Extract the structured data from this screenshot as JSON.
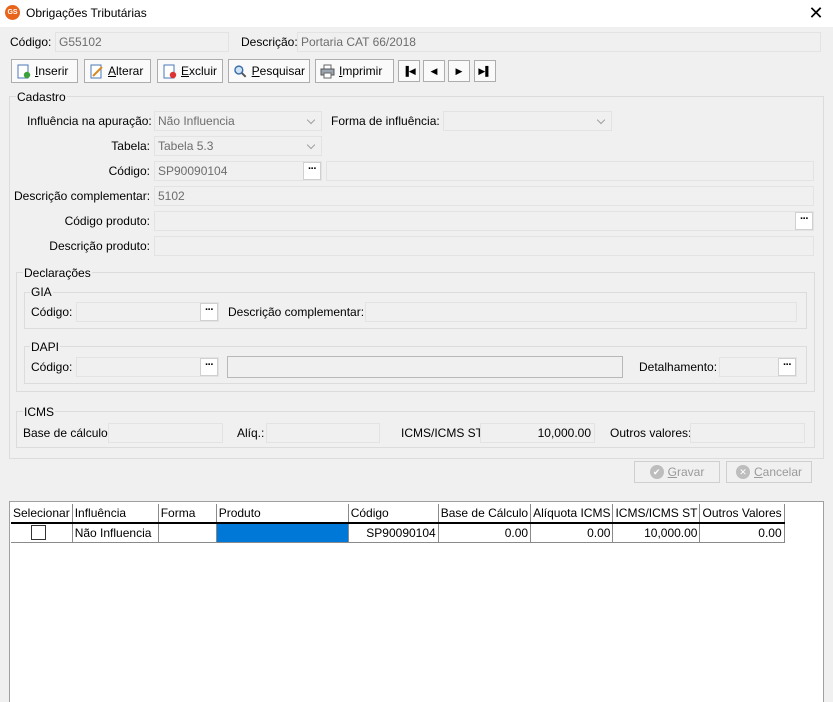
{
  "window": {
    "title": "Obrigações Tributárias",
    "app_icon": "GS"
  },
  "header": {
    "codigo_label": "Código:",
    "codigo_value": "G55102",
    "descricao_label": "Descrição:",
    "descricao_value": "Portaria CAT 66/2018"
  },
  "toolbar": {
    "inserir": "Inserir",
    "alterar": "Alterar",
    "excluir": "Excluir",
    "pesquisar": "Pesquisar",
    "imprimir": "Imprimir"
  },
  "cadastro": {
    "title": "Cadastro",
    "influencia_label": "Influência na apuração:",
    "influencia_value": "Não Influencia",
    "forma_label": "Forma de influência:",
    "forma_value": "",
    "tabela_label": "Tabela:",
    "tabela_value": "Tabela 5.3",
    "codigo_label": "Código:",
    "codigo_value": "SP90090104",
    "codigo_desc": "",
    "desc_comp_label": "Descrição complementar:",
    "desc_comp_value": "5102",
    "cod_produto_label": "Código produto:",
    "cod_produto_value": "",
    "desc_produto_label": "Descrição produto:",
    "desc_produto_value": ""
  },
  "declaracoes": {
    "title": "Declarações",
    "gia": {
      "title": "GIA",
      "codigo_label": "Código:",
      "desc_label": "Descrição complementar:"
    },
    "dapi": {
      "title": "DAPI",
      "codigo_label": "Código:",
      "detalhamento_label": "Detalhamento:"
    }
  },
  "icms": {
    "title": "ICMS",
    "base_label": "Base de cálculo:",
    "base_value": "",
    "aliq_label": "Alíq.:",
    "aliq_value": "",
    "icms_st_label": "ICMS/ICMS ST:",
    "icms_st_value": "10,000.00",
    "outros_label": "Outros valores:",
    "outros_value": ""
  },
  "actions": {
    "gravar": "Gravar",
    "cancelar": "Cancelar"
  },
  "grid": {
    "columns": [
      "Selecionar",
      "Influência",
      "Forma",
      "Produto",
      "Código",
      "Base de Cálculo",
      "Alíquota ICMS",
      "ICMS/ICMS ST",
      "Outros Valores"
    ],
    "rows": [
      {
        "selecionar": false,
        "influencia": "Não Influencia",
        "forma": "",
        "produto": "",
        "codigo": "SP90090104",
        "base": "0.00",
        "aliquota": "0.00",
        "icms_st": "10,000.00",
        "outros": "0.00"
      }
    ]
  },
  "colors": {
    "accent": "#0078d7",
    "app_icon": "#e8641b"
  }
}
